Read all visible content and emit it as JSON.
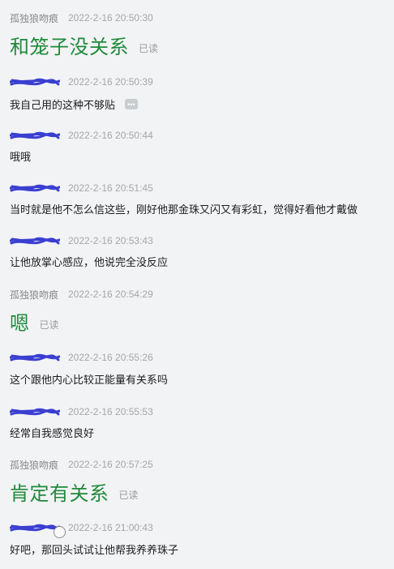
{
  "messages": [
    {
      "sender": "孤独狼吻痕",
      "time": "2022-2-16 20:50:30",
      "text": "和笼子没关系",
      "read": "已读"
    },
    {
      "sender_redacted": true,
      "time": "2022-2-16 20:50:39",
      "text": "我自己用的这种不够贴"
    },
    {
      "sender_redacted": true,
      "time": "2022-2-16 20:50:44",
      "text": "哦哦"
    },
    {
      "sender_redacted": true,
      "time": "2022-2-16 20:51:45",
      "text": "当时就是他不怎么信这些，刚好他那金珠又闪又有彩虹，觉得好看他才戴做"
    },
    {
      "sender_redacted": true,
      "time": "2022-2-16 20:53:43",
      "text": "让他放掌心感应，他说完全没反应"
    },
    {
      "sender": "孤独狼吻痕",
      "time": "2022-2-16 20:54:29",
      "text": "嗯",
      "read": "已读"
    },
    {
      "sender_redacted": true,
      "time": "2022-2-16 20:55:26",
      "text": "这个跟他内心比较正能量有关系吗"
    },
    {
      "sender_redacted": true,
      "time": "2022-2-16 20:55:53",
      "text": "经常自我感觉良好"
    },
    {
      "sender": "孤独狼吻痕",
      "time": "2022-2-16 20:57:25",
      "text": "肯定有关系",
      "read": "已读"
    },
    {
      "sender_redacted": true,
      "time": "2022-2-16 21:00:43",
      "text": "好吧，那回头试试让他帮我养养珠子"
    }
  ],
  "more_button_label": "•••",
  "colors": {
    "background": "#f2f3f5",
    "big_text": "#1f8a3a",
    "redaction": "#3a3fd1"
  }
}
